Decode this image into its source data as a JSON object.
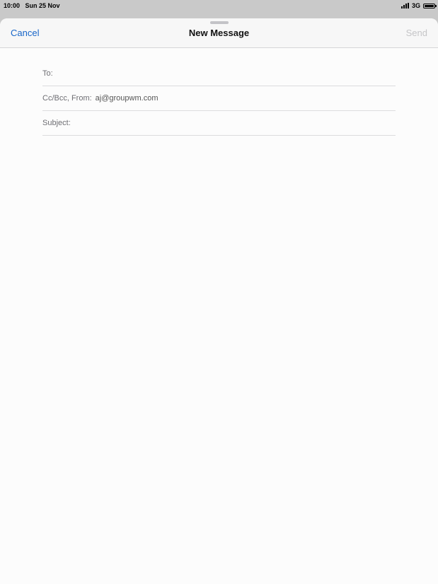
{
  "status_bar": {
    "time": "10:00",
    "date": "Sun 25 Nov",
    "network": "3G",
    "battery_level": 1.0,
    "icons": [
      "signal-icon",
      "battery-icon"
    ]
  },
  "nav": {
    "cancel_label": "Cancel",
    "title": "New Message",
    "send_label": "Send"
  },
  "form": {
    "to_label": "To:",
    "to_value": "",
    "ccbcc_label": "Cc/Bcc, From:",
    "from_value": "aj@groupwm.com",
    "subject_label": "Subject:",
    "subject_value": ""
  },
  "colors": {
    "accent": "#1765c8",
    "disabled": "#c5c5c7"
  }
}
